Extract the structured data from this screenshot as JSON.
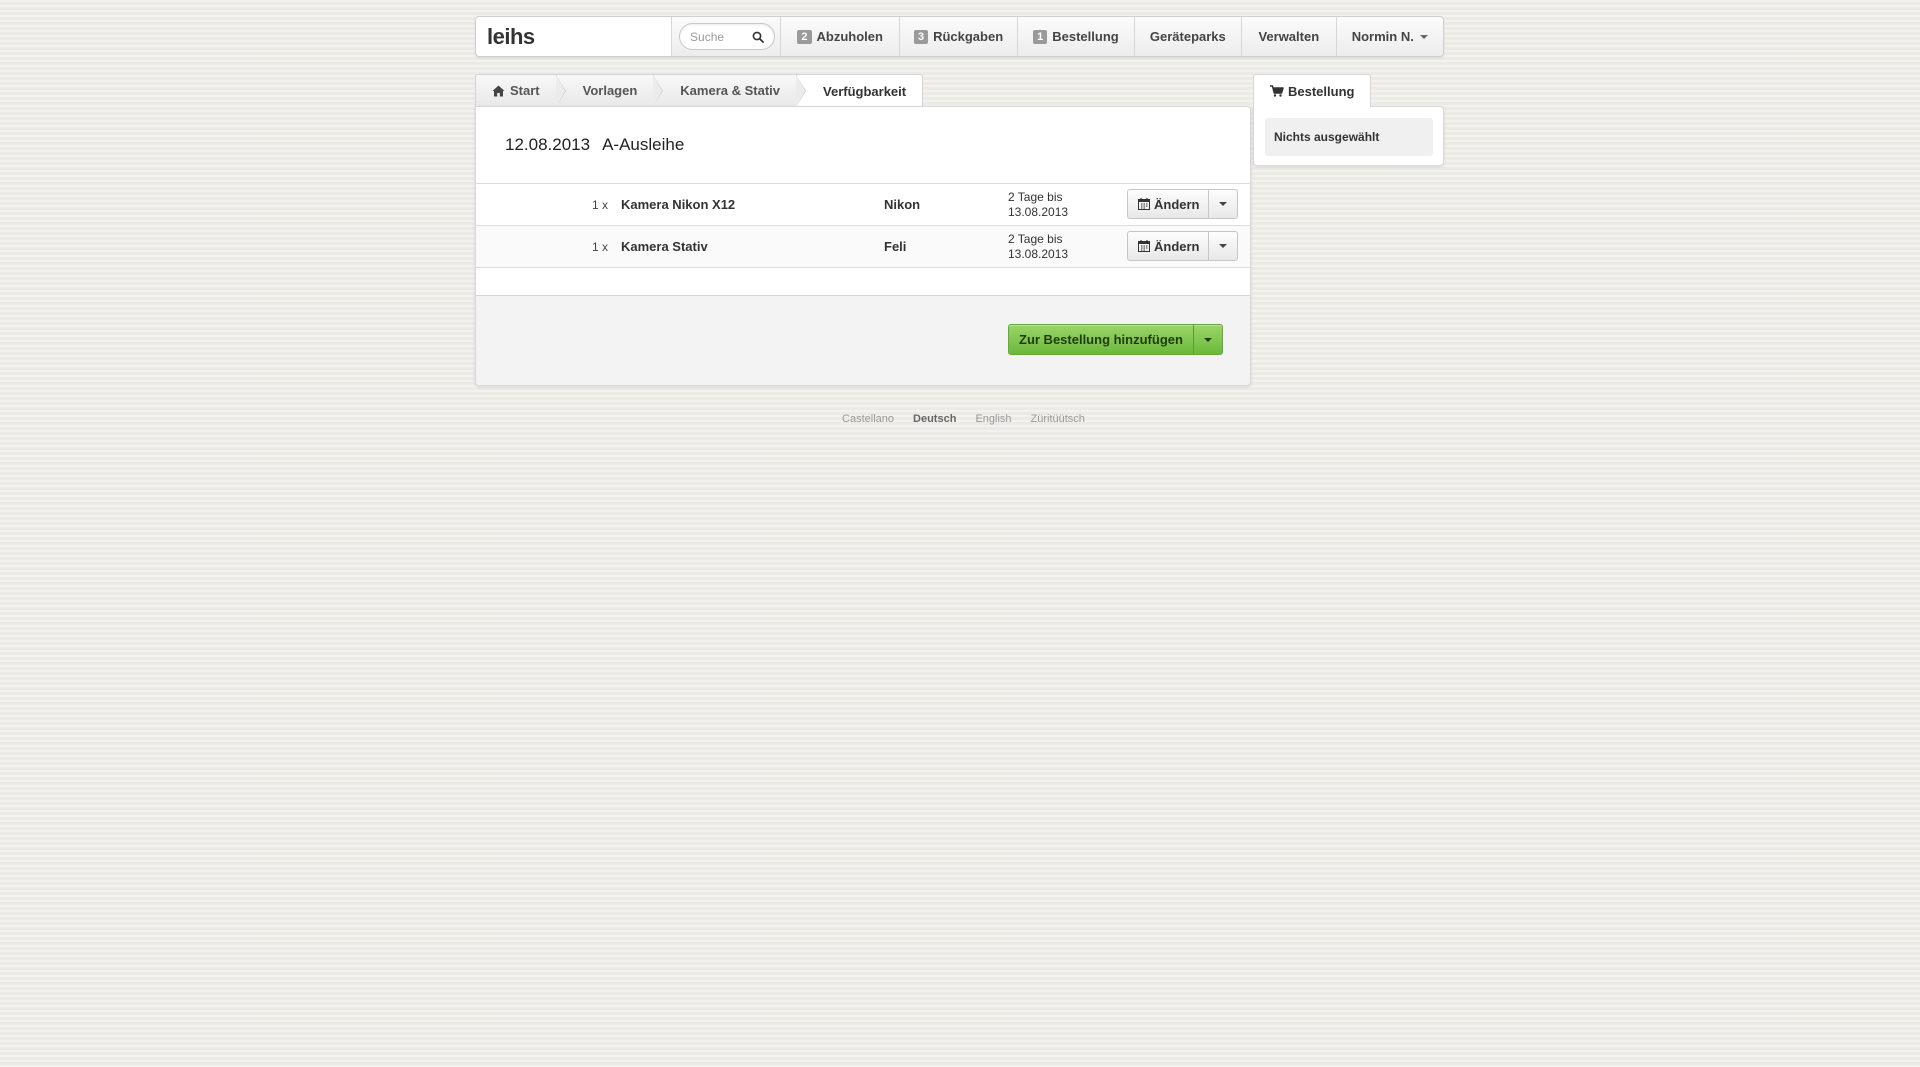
{
  "app": {
    "logo": "leihs"
  },
  "search": {
    "placeholder": "Suche"
  },
  "nav": {
    "pickups": {
      "count": "2",
      "label": "Abzuholen"
    },
    "returns": {
      "count": "3",
      "label": "Rückgaben"
    },
    "order": {
      "count": "1",
      "label": "Bestellung"
    },
    "inventory_pools": {
      "label": "Geräteparks"
    },
    "manage": {
      "label": "Verwalten"
    },
    "user": {
      "label": "Normin N."
    }
  },
  "breadcrumbs": [
    {
      "label": "Start",
      "icon": "home-icon"
    },
    {
      "label": "Vorlagen"
    },
    {
      "label": "Kamera & Stativ"
    },
    {
      "label": "Verfügbarkeit"
    }
  ],
  "main": {
    "date": "12.08.2013",
    "pool": "A-Ausleihe",
    "rows": [
      {
        "qty": "1 x",
        "name": "Kamera Nikon X12",
        "manufacturer": "Nikon",
        "duration_line1": "2 Tage bis",
        "duration_line2": "13.08.2013",
        "button": "Ändern"
      },
      {
        "qty": "1 x",
        "name": "Kamera Stativ",
        "manufacturer": "Feli",
        "duration_line1": "2 Tage bis",
        "duration_line2": "13.08.2013",
        "button": "Ändern"
      }
    ],
    "submit_label": "Zur Bestellung hinzufügen"
  },
  "side": {
    "tab_label": "Bestellung",
    "empty_text": "Nichts ausgewählt"
  },
  "languages": [
    {
      "label": "Castellano",
      "current": false
    },
    {
      "label": "Deutsch",
      "current": true
    },
    {
      "label": "English",
      "current": false
    },
    {
      "label": "Züritüütsch",
      "current": false
    }
  ],
  "colors": {
    "primary_button": "#7cc44e",
    "background": "#efede8"
  }
}
